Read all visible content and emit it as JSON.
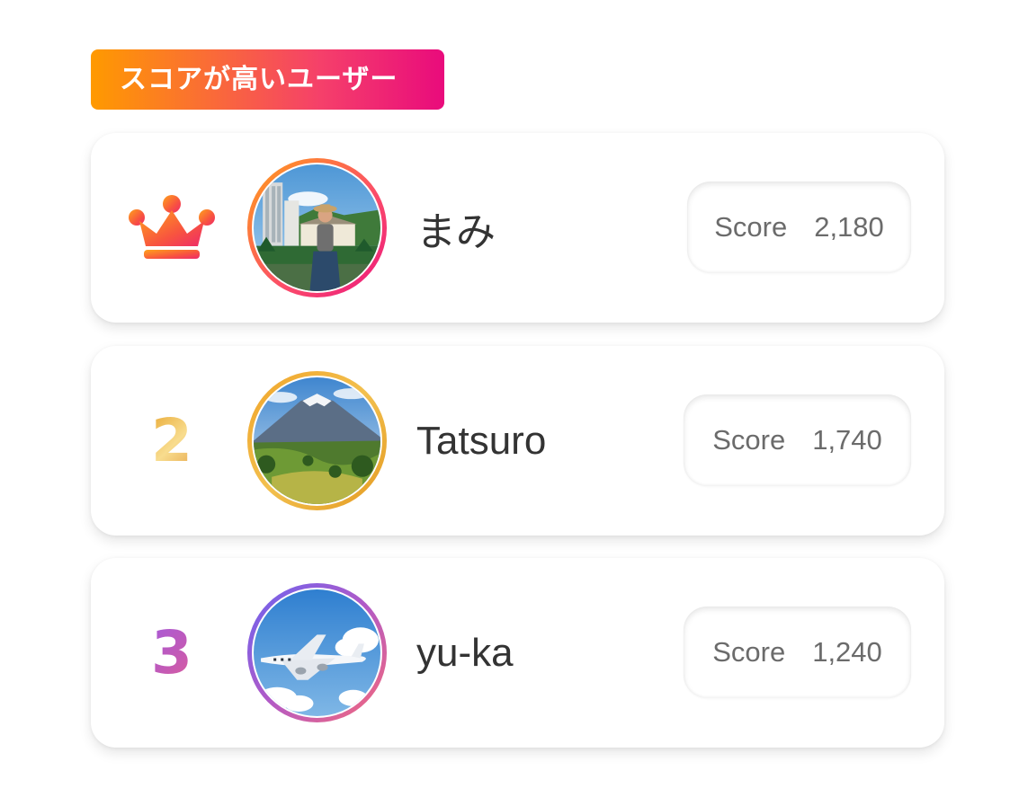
{
  "section": {
    "title": "スコアが高いユーザー"
  },
  "ranking": [
    {
      "rank": 1,
      "rank_display": "crown-icon",
      "name": "まみ",
      "score_label": "Score",
      "score": "2,180",
      "avatar": "photo of woman in a hat by resort buildings and mountains",
      "ring_colors": [
        "#ff9f1a",
        "#ea167e"
      ]
    },
    {
      "rank": 2,
      "rank_display": "2",
      "name": "Tatsuro",
      "score_label": "Score",
      "score": "1,740",
      "avatar": "photo of Mount Fuji over green valley",
      "ring_colors": [
        "#f0a42a",
        "#e49a20"
      ]
    },
    {
      "rank": 3,
      "rank_display": "3",
      "name": "yu-ka",
      "score_label": "Score",
      "score": "1,240",
      "avatar": "photo of airplane in blue sky with clouds",
      "ring_colors": [
        "#6b63f0",
        "#f76978"
      ]
    }
  ],
  "colors": {
    "title_gradient_start": "#ff9a00",
    "title_gradient_end": "#e90b7c",
    "gold": "#e9a934",
    "purple": "#b15ac7"
  }
}
